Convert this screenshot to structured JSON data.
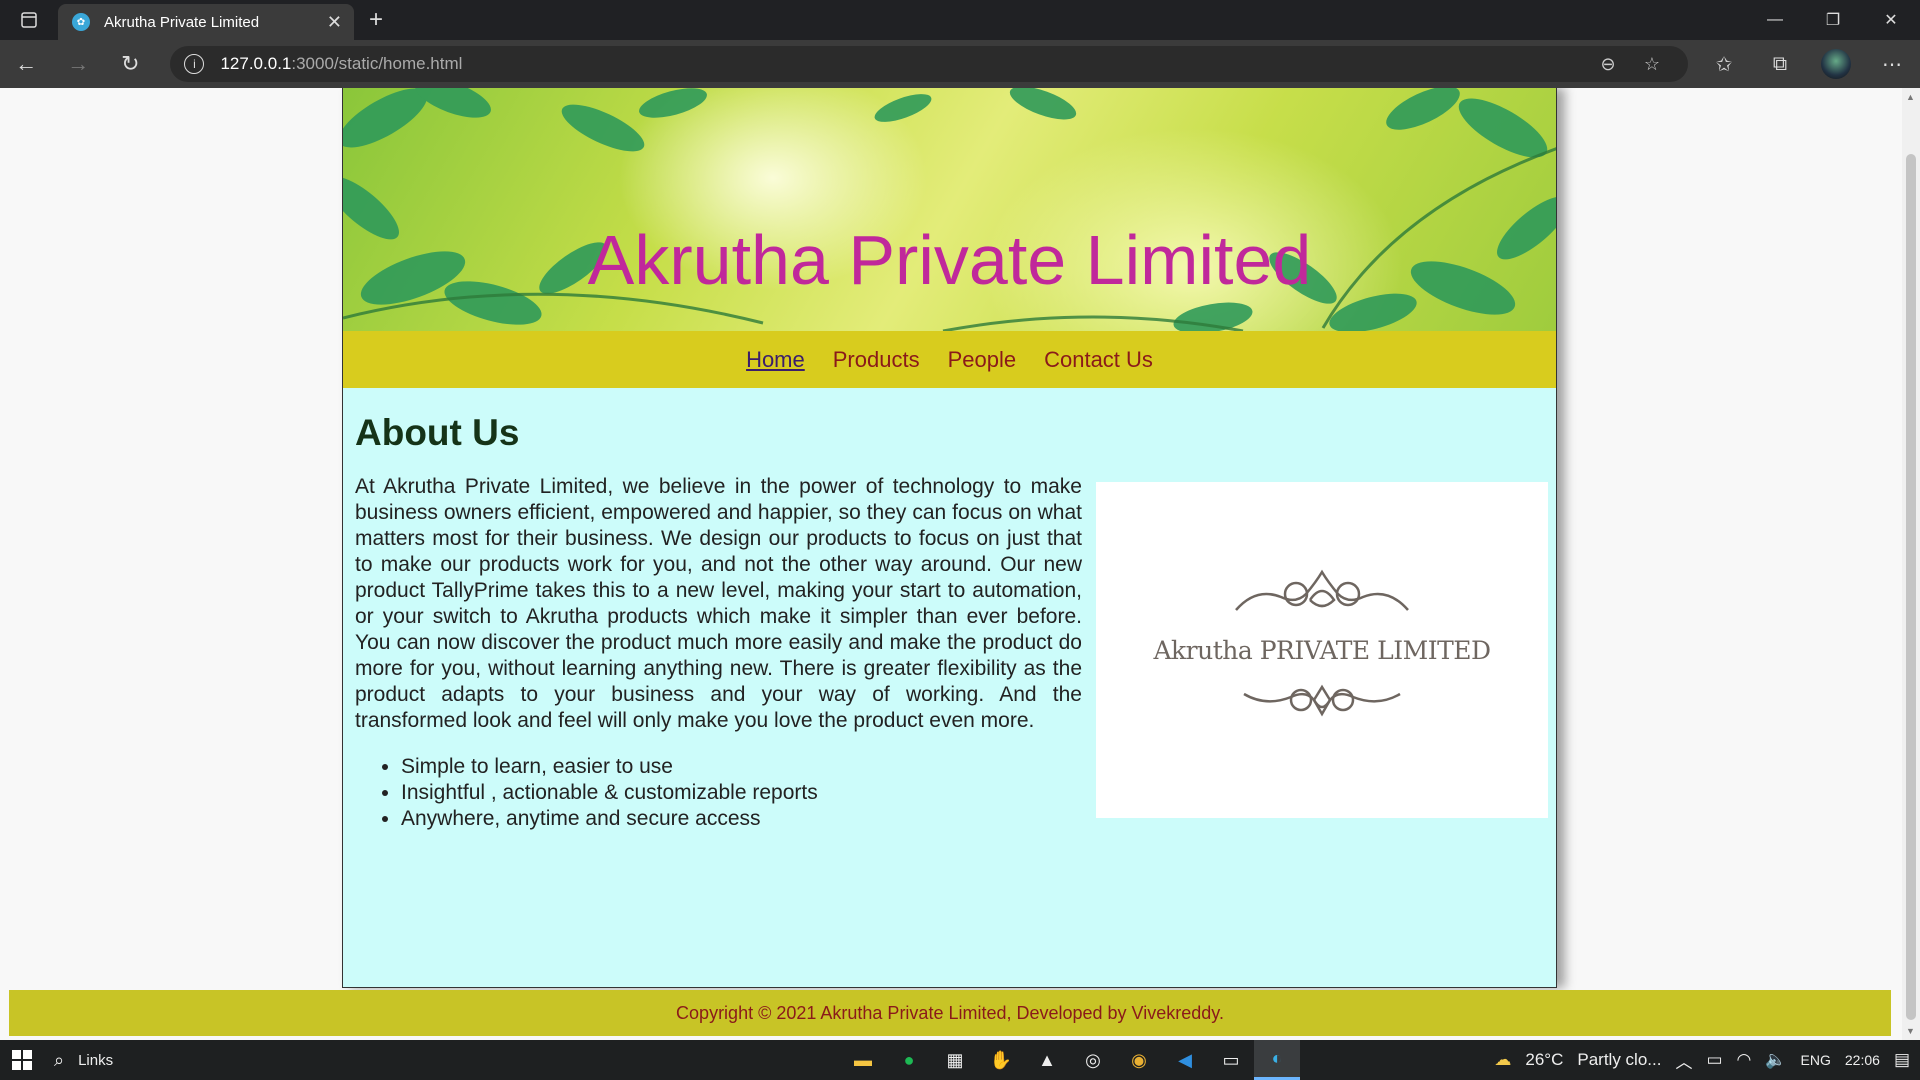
{
  "browser": {
    "tab_title": "Akrutha Private Limited",
    "tab_close": "✕",
    "new_tab": "+",
    "url_host": "127.0.0.1",
    "url_rest": ":3000/static/home.html",
    "window": {
      "minimize": "—",
      "restore": "❐",
      "close": "✕"
    }
  },
  "site": {
    "banner_title": "Akrutha Private Limited",
    "nav": [
      {
        "label": "Home",
        "active": true
      },
      {
        "label": "Products"
      },
      {
        "label": "People"
      },
      {
        "label": "Contact Us"
      }
    ],
    "about": {
      "heading": "About Us",
      "paragraph": "At Akrutha Private Limited, we believe in the power of technology to make business owners efficient, empowered and happier, so they can focus on what matters most for their business. We design our products to focus on just that to make our products work for you, and not the other way around. Our new product TallyPrime takes this to a new level, making your start to automation, or your switch to Akrutha products which make it simpler than ever before. You can now discover the product much more easily and make the product do more for you, without learning anything new. There is greater flexibility as the product adapts to your business and your way of working. And the transformed look and feel will only make you love the product even more.",
      "bullets": [
        "Simple to learn, easier to use",
        "Insightful , actionable & customizable reports",
        "Anywhere, anytime and secure access"
      ],
      "logo_text": "Akrutha PRIVATE LIMITED"
    },
    "footer": "Copyright © 2021 Akrutha Private Limited, Developed by Vivekreddy."
  },
  "taskbar": {
    "search_label": "Links",
    "weather": "26°C",
    "weather_desc": "Partly clo...",
    "language": "ENG",
    "time": "22:06"
  },
  "colors": {
    "banner_title": "#c0289b",
    "nav_bar": "#d8cc1e",
    "content_bg": "#ccfcfa",
    "footer_bg": "#c8c426",
    "link_text": "#8a1a1a"
  }
}
